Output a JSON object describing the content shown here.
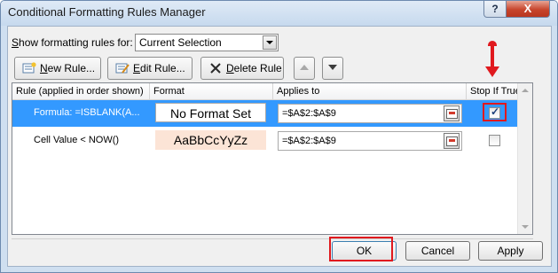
{
  "window": {
    "title": "Conditional Formatting Rules Manager",
    "help_glyph": "?",
    "close_glyph": "X"
  },
  "show_rules": {
    "label_prefix": "S",
    "label_rest": "how formatting rules for:",
    "selected_value": "Current Selection"
  },
  "toolbar": {
    "new_prefix": "N",
    "new_rest": "ew Rule...",
    "edit_prefix": "E",
    "edit_rest": "dit Rule...",
    "delete_prefix": "D",
    "delete_rest": "elete Rule",
    "move_up_icon": "arrow-up-icon",
    "move_down_icon": "arrow-down-icon"
  },
  "table": {
    "headers": {
      "rule": "Rule (applied in order shown)",
      "format": "Format",
      "applies_to": "Applies to",
      "stop_if_true": "Stop If True"
    },
    "rows": [
      {
        "rule": "Formula: =ISBLANK(A...",
        "format": "No Format Set",
        "applies_to": "=$A$2:$A$9",
        "stop_if_true": true,
        "selected": true
      },
      {
        "rule": "Cell Value < NOW()",
        "format": "AaBbCcYyZz",
        "applies_to": "=$A$2:$A$9",
        "stop_if_true": false,
        "selected": false
      }
    ]
  },
  "buttons": {
    "ok": "OK",
    "cancel": "Cancel",
    "apply": "Apply"
  },
  "colors": {
    "selection": "#3399ff",
    "highlight": "#e0191e",
    "format_preview_fill": "#fce4d6"
  },
  "checkmark_glyph": "✓"
}
